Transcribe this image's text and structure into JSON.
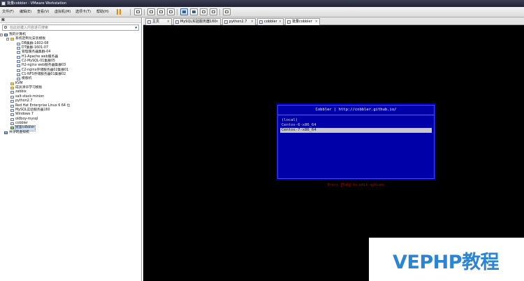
{
  "window": {
    "title": "批量cobbler - VMware Workstation"
  },
  "menu": [
    "文件(F)",
    "编辑(E)",
    "查看(V)",
    "虚拟机(M)",
    "选项卡(T)",
    "帮助(H)"
  ],
  "library": {
    "header": "库",
    "search_placeholder": "在此处键入内容进行搜索",
    "items": [
      {
        "label": "我的计算机",
        "level": 0,
        "icon": "computer-icon",
        "expander": "-"
      },
      {
        "label": "系统定制化安装模板",
        "level": 1,
        "icon": "folder-icon",
        "expander": "-"
      },
      {
        "label": "DB集群-1602-08",
        "level": 2,
        "icon": "vm-icon"
      },
      {
        "label": "DT集群-1601-07",
        "level": 2,
        "icon": "vm-icon"
      },
      {
        "label": "管理服务器集群-04",
        "level": 2,
        "icon": "vm-icon"
      },
      {
        "label": "H1-Apache web服务器",
        "level": 2,
        "icon": "vm-icon"
      },
      {
        "label": "C2-MySQL-01集群05",
        "level": 2,
        "icon": "vm-icon"
      },
      {
        "label": "H2-nginx web服务器集群03",
        "level": 2,
        "icon": "vm-icon"
      },
      {
        "label": "C2-nginx存储服务器02集群01",
        "level": 2,
        "icon": "vm-icon"
      },
      {
        "label": "C1-NFS存储服务器01集群02",
        "level": 2,
        "icon": "vm-icon"
      },
      {
        "label": "模版机",
        "level": 2,
        "icon": "vm-icon"
      },
      {
        "label": "KVM",
        "level": 1,
        "icon": "folder-icon"
      },
      {
        "label": "成员清华学习模板",
        "level": 1,
        "icon": "folder-icon"
      },
      {
        "label": "zabbix",
        "level": 1,
        "icon": "vm-icon"
      },
      {
        "label": "salt-stack-minion",
        "level": 1,
        "icon": "vm-icon"
      },
      {
        "label": "python2.7",
        "level": 1,
        "icon": "vm-icon"
      },
      {
        "label": "Red Hat Enterprise Linux 6 64 位",
        "level": 1,
        "icon": "vm-icon"
      },
      {
        "label": "MySQL实验服务器160",
        "level": 1,
        "icon": "vm-icon"
      },
      {
        "label": "Windows 7",
        "level": 1,
        "icon": "vm-icon"
      },
      {
        "label": "oldboy-mysql",
        "level": 1,
        "icon": "vm-icon"
      },
      {
        "label": "cobbler",
        "level": 1,
        "icon": "vm-icon"
      },
      {
        "label": "批量cobbler",
        "level": 1,
        "icon": "vm-icon",
        "selected": true,
        "running": true
      },
      {
        "label": "共享的虚拟机",
        "level": 0,
        "icon": "computer-icon"
      }
    ]
  },
  "tabs": [
    {
      "label": "主页"
    },
    {
      "label": "MySQL实验服务器160"
    },
    {
      "label": "python2.7"
    },
    {
      "label": "cobbler"
    },
    {
      "label": "批量cobbler",
      "active": true
    }
  ],
  "console": {
    "boot_title": "Cobbler | http://cobbler.github.io/",
    "entries": [
      "(local)",
      "Centos-6-x86_64",
      "Centos-7-x86_64"
    ],
    "selected_index": 2,
    "hint": "Press [Tab] to edit options"
  },
  "watermark": "VEPHP教程",
  "colors": {
    "boot_bg": "#0000a8",
    "hint": "#c00000",
    "watermark": "#2a86d4"
  }
}
